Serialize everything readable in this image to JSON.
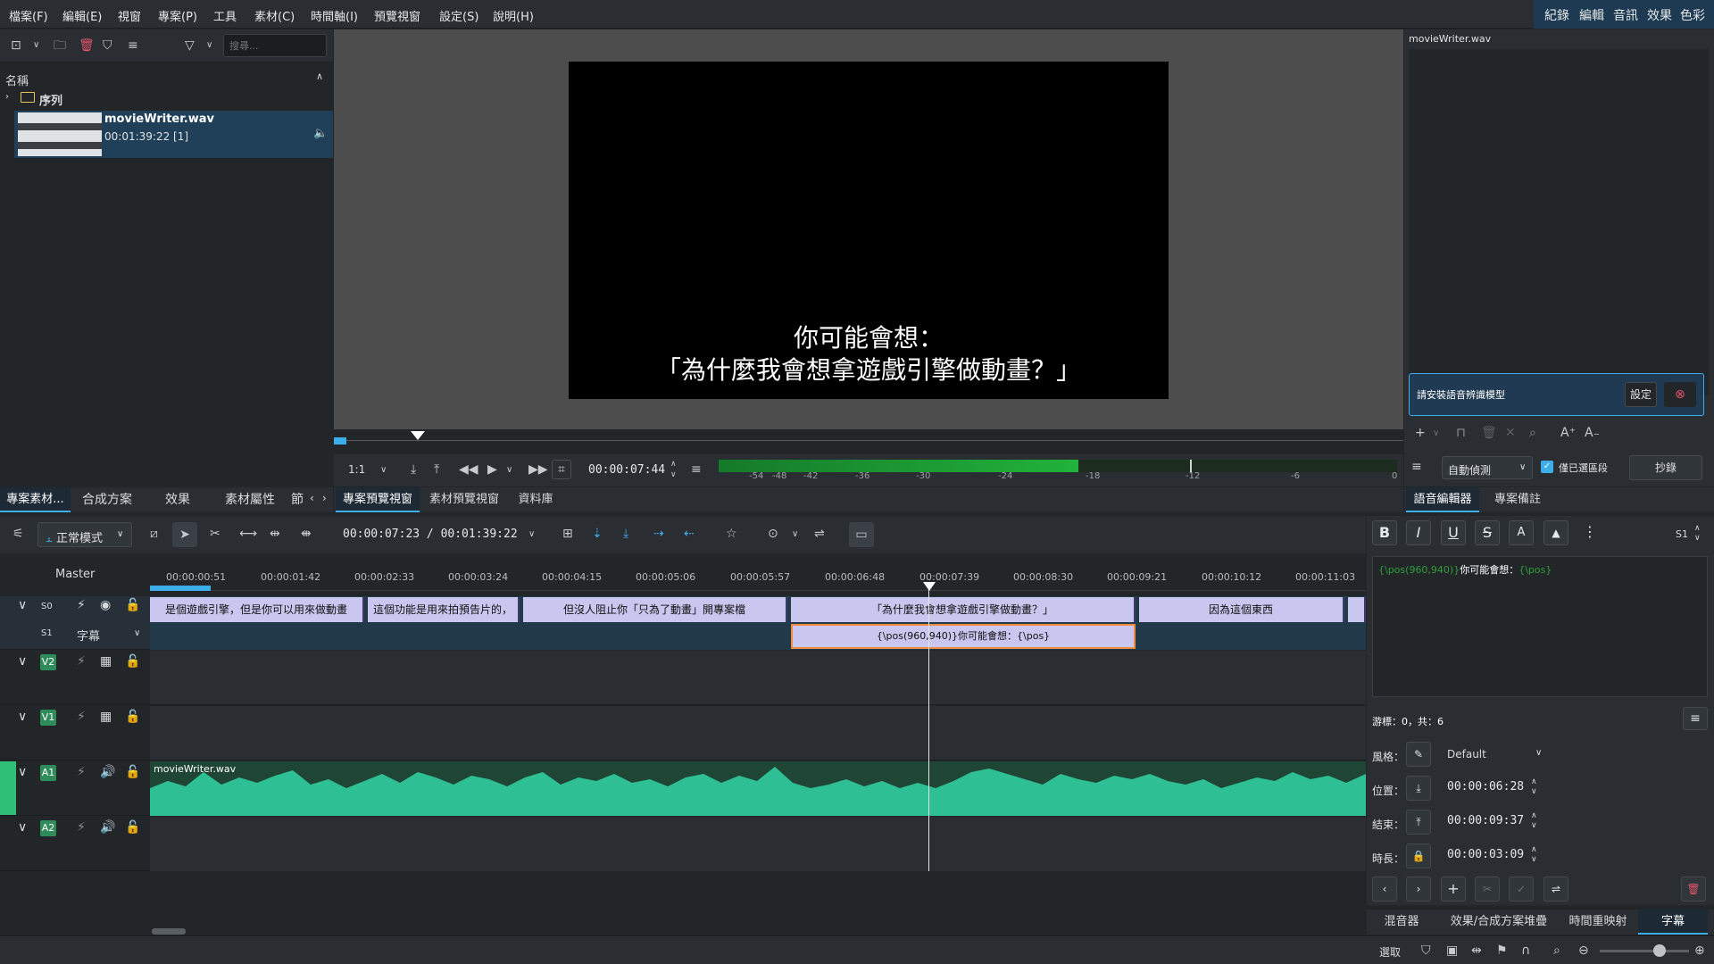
{
  "menu": [
    "檔案(F)",
    "編輯(E)",
    "視窗",
    "專案(P)",
    "工具",
    "素材(C)",
    "時間軸(I)",
    "預覽視窗",
    "設定(S)",
    "說明(H)"
  ],
  "workspaces": [
    "紀錄",
    "編輯",
    "音訊",
    "效果",
    "色彩"
  ],
  "bin": {
    "search_placeholder": "搜尋...",
    "header": "名稱",
    "folder": "序列",
    "clip_name": "movieWriter.wav",
    "clip_duration": "00:01:39:22 [1]"
  },
  "left_tabs": [
    "專案素材...",
    "合成方案",
    "效果",
    "素材屬性",
    "節"
  ],
  "monitor": {
    "subtitle_line1": "你可能會想：",
    "subtitle_line2": "「為什麼我會想拿遊戲引擎做動畫？」",
    "zoom": "1:1",
    "timecode": "00:00:07:44",
    "meter_labels": [
      "-54",
      "-48",
      "-42",
      "-36",
      "-30",
      "-24",
      "-18",
      "-12",
      "-6",
      "0"
    ],
    "meter_level": 0.53
  },
  "monitor_tabs": [
    "專案預覽視窗",
    "素材預覽視窗",
    "資料庫"
  ],
  "speech": {
    "title": "movieWriter.wav",
    "install_msg": "請安裝語音辨識模型",
    "settings_btn": "設定",
    "auto_detect": "自動偵測",
    "selected_only": "僅已選區段",
    "transcribe_btn": "抄錄"
  },
  "right_tabs": [
    "語音編輯器",
    "專案備註"
  ],
  "timeline": {
    "mode": "正常模式",
    "position": "00:00:07:23 / 00:01:39:22",
    "master": "Master",
    "ruler": [
      "00:00:00:51",
      "00:00:01:42",
      "00:00:02:33",
      "00:00:03:24",
      "00:00:04:15",
      "00:00:05:06",
      "00:00:05:57",
      "00:00:06:48",
      "00:00:07:39",
      "00:00:08:30",
      "00:00:09:21",
      "00:00:10:12",
      "00:00:11:03"
    ],
    "tracks": {
      "s0": "S0",
      "s1": "S1",
      "s1_name": "字幕",
      "v2": "V2",
      "v1": "V1",
      "a1": "A1",
      "a2": "A2"
    },
    "subtitle_clips": [
      "是個遊戲引擎，但是你可以用來做動畫",
      "這個功能是用來拍預告片的，",
      "但沒人阻止你「只為了動畫」開專案檔",
      "「為什麼我會想拿遊戲引擎做動畫？」",
      "因為這個東西"
    ],
    "selected_clip": "{\\pos(960,940)}你可能會想：{\\pos}",
    "audio_clip": "movieWriter.wav"
  },
  "subtitle_editor": {
    "layer": "S1",
    "text_open": "{\\pos(960,940)}",
    "text_body": "你可能會想：",
    "text_close": "{\\pos}",
    "cursor_info": "游標：0，共：6",
    "style_label": "風格：",
    "style_value": "Default",
    "pos_label": "位置：",
    "pos_value": "00:00:06:28",
    "end_label": "結束：",
    "end_value": "00:00:09:37",
    "dur_label": "時長：",
    "dur_value": "00:00:03:09"
  },
  "bottom_tabs": [
    "混音器",
    "效果/合成方案堆疊",
    "時間重映射",
    "字幕"
  ],
  "status": {
    "select": "選取"
  },
  "colors": {
    "accent": "#3daee9",
    "subtitle_clip": "#c9c6ef",
    "audio_wave": "#2fbf94",
    "selected_border": "#f08a3e"
  }
}
